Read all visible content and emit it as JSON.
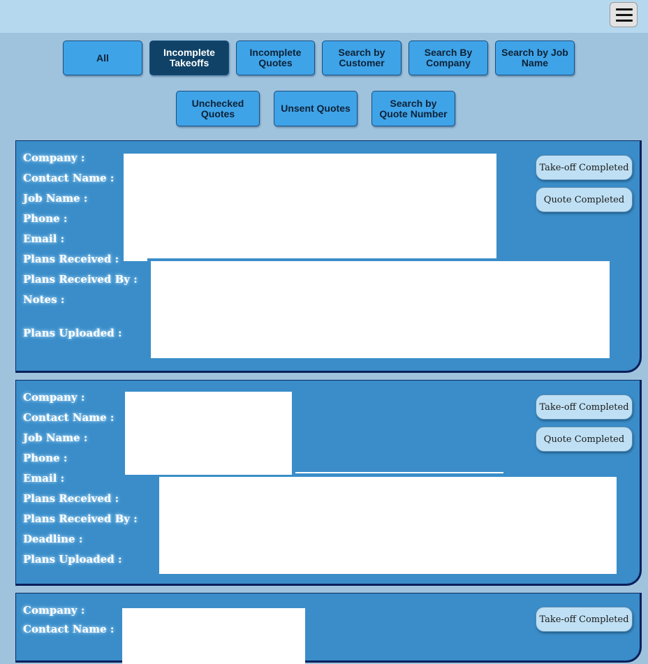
{
  "nav": {
    "menu_icon": "hamburger-icon"
  },
  "filters": [
    {
      "label": "All",
      "active": false
    },
    {
      "label": "Incomplete Takeoffs",
      "active": true
    },
    {
      "label": "Incomplete Quotes",
      "active": false
    },
    {
      "label": "Search by Customer",
      "active": false
    },
    {
      "label": "Search By Company",
      "active": false
    },
    {
      "label": "Search by Job Name",
      "active": false
    },
    {
      "label": "Unchecked Quotes",
      "active": false
    },
    {
      "label": "Unsent Quotes",
      "active": false
    },
    {
      "label": "Search by Quote Number",
      "active": false
    }
  ],
  "cards": [
    {
      "labels": [
        "Company :",
        "Contact Name :",
        "Job Name :",
        "Phone :",
        "Email :",
        "Plans Received :",
        "Plans Received By :",
        "Notes :",
        "Plans Uploaded :"
      ],
      "buttons": [
        "Take-off Completed",
        "Quote Completed"
      ]
    },
    {
      "labels": [
        "Company :",
        "Contact Name :",
        "Job Name :",
        "Phone :",
        "Email :",
        "Plans Received :",
        "Plans Received By :",
        "Deadline :",
        "Plans Uploaded :"
      ],
      "buttons": [
        "Take-off Completed",
        "Quote Completed"
      ]
    },
    {
      "labels": [
        "Company :",
        "Contact Name :"
      ],
      "buttons": [
        "Take-off Completed"
      ]
    }
  ],
  "colors": {
    "page_bg": "#9fc3dd",
    "header_bg": "#b5d8ee",
    "filter_button": "#3fa3e8",
    "filter_button_active": "#0f4266",
    "card_bg": "#3a8dc9",
    "status_button": "#bfe0f4"
  }
}
